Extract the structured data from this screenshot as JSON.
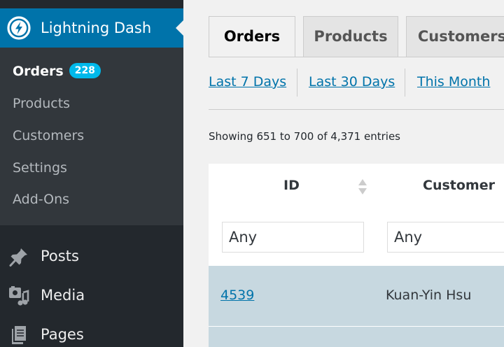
{
  "sidebar": {
    "app_title": "Lightning Dash",
    "submenu": [
      {
        "label": "Orders",
        "badge": "228",
        "current": true
      },
      {
        "label": "Products"
      },
      {
        "label": "Customers"
      },
      {
        "label": "Settings"
      },
      {
        "label": "Add-Ons"
      }
    ],
    "menu": [
      {
        "label": "Posts",
        "icon": "pushpin-icon"
      },
      {
        "label": "Media",
        "icon": "media-icon"
      },
      {
        "label": "Pages",
        "icon": "pages-icon"
      }
    ]
  },
  "tabs": [
    {
      "label": "Orders",
      "active": true
    },
    {
      "label": "Products"
    },
    {
      "label": "Customers"
    }
  ],
  "date_ranges": [
    "Last 7 Days",
    "Last 30 Days",
    "This Month"
  ],
  "showing_text": "Showing 651 to 700 of 4,371 entries",
  "table": {
    "columns": [
      "ID",
      "Customer"
    ],
    "filters": [
      "Any",
      "Any"
    ],
    "rows": [
      {
        "id": "4539",
        "customer": "Kuan-Yin Hsu"
      }
    ]
  },
  "colors": {
    "accent": "#0073aa",
    "sidebar": "#23282d",
    "submenu": "#32373c",
    "badge": "#00b9eb",
    "row_highlight": "#c7d8e0"
  }
}
